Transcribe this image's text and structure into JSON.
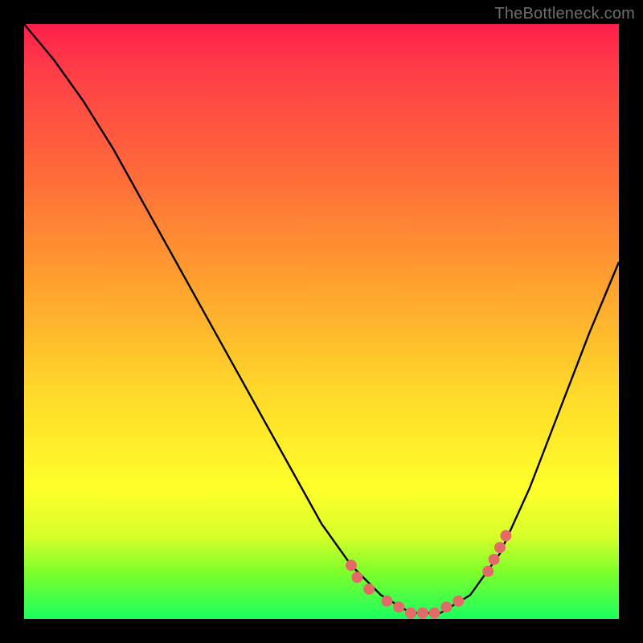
{
  "watermark": "TheBottleneck.com",
  "chart_data": {
    "type": "line",
    "title": "",
    "xlabel": "",
    "ylabel": "",
    "xlim": [
      0,
      1
    ],
    "ylim": [
      0,
      1
    ],
    "curve": [
      {
        "x": 0.0,
        "y": 1.0
      },
      {
        "x": 0.05,
        "y": 0.94
      },
      {
        "x": 0.1,
        "y": 0.87
      },
      {
        "x": 0.15,
        "y": 0.79
      },
      {
        "x": 0.2,
        "y": 0.7
      },
      {
        "x": 0.25,
        "y": 0.61
      },
      {
        "x": 0.3,
        "y": 0.52
      },
      {
        "x": 0.35,
        "y": 0.43
      },
      {
        "x": 0.4,
        "y": 0.34
      },
      {
        "x": 0.45,
        "y": 0.25
      },
      {
        "x": 0.5,
        "y": 0.16
      },
      {
        "x": 0.55,
        "y": 0.09
      },
      {
        "x": 0.6,
        "y": 0.04
      },
      {
        "x": 0.65,
        "y": 0.01
      },
      {
        "x": 0.7,
        "y": 0.01
      },
      {
        "x": 0.75,
        "y": 0.04
      },
      {
        "x": 0.8,
        "y": 0.11
      },
      {
        "x": 0.85,
        "y": 0.22
      },
      {
        "x": 0.9,
        "y": 0.35
      },
      {
        "x": 0.95,
        "y": 0.48
      },
      {
        "x": 1.0,
        "y": 0.6
      }
    ],
    "markers": [
      {
        "x": 0.55,
        "y": 0.09
      },
      {
        "x": 0.56,
        "y": 0.07
      },
      {
        "x": 0.58,
        "y": 0.05
      },
      {
        "x": 0.61,
        "y": 0.03
      },
      {
        "x": 0.63,
        "y": 0.02
      },
      {
        "x": 0.65,
        "y": 0.01
      },
      {
        "x": 0.67,
        "y": 0.01
      },
      {
        "x": 0.69,
        "y": 0.01
      },
      {
        "x": 0.71,
        "y": 0.02
      },
      {
        "x": 0.73,
        "y": 0.03
      },
      {
        "x": 0.78,
        "y": 0.08
      },
      {
        "x": 0.79,
        "y": 0.1
      },
      {
        "x": 0.8,
        "y": 0.12
      },
      {
        "x": 0.81,
        "y": 0.14
      }
    ],
    "marker_color": "#e46a6a",
    "curve_color": "#000000"
  }
}
